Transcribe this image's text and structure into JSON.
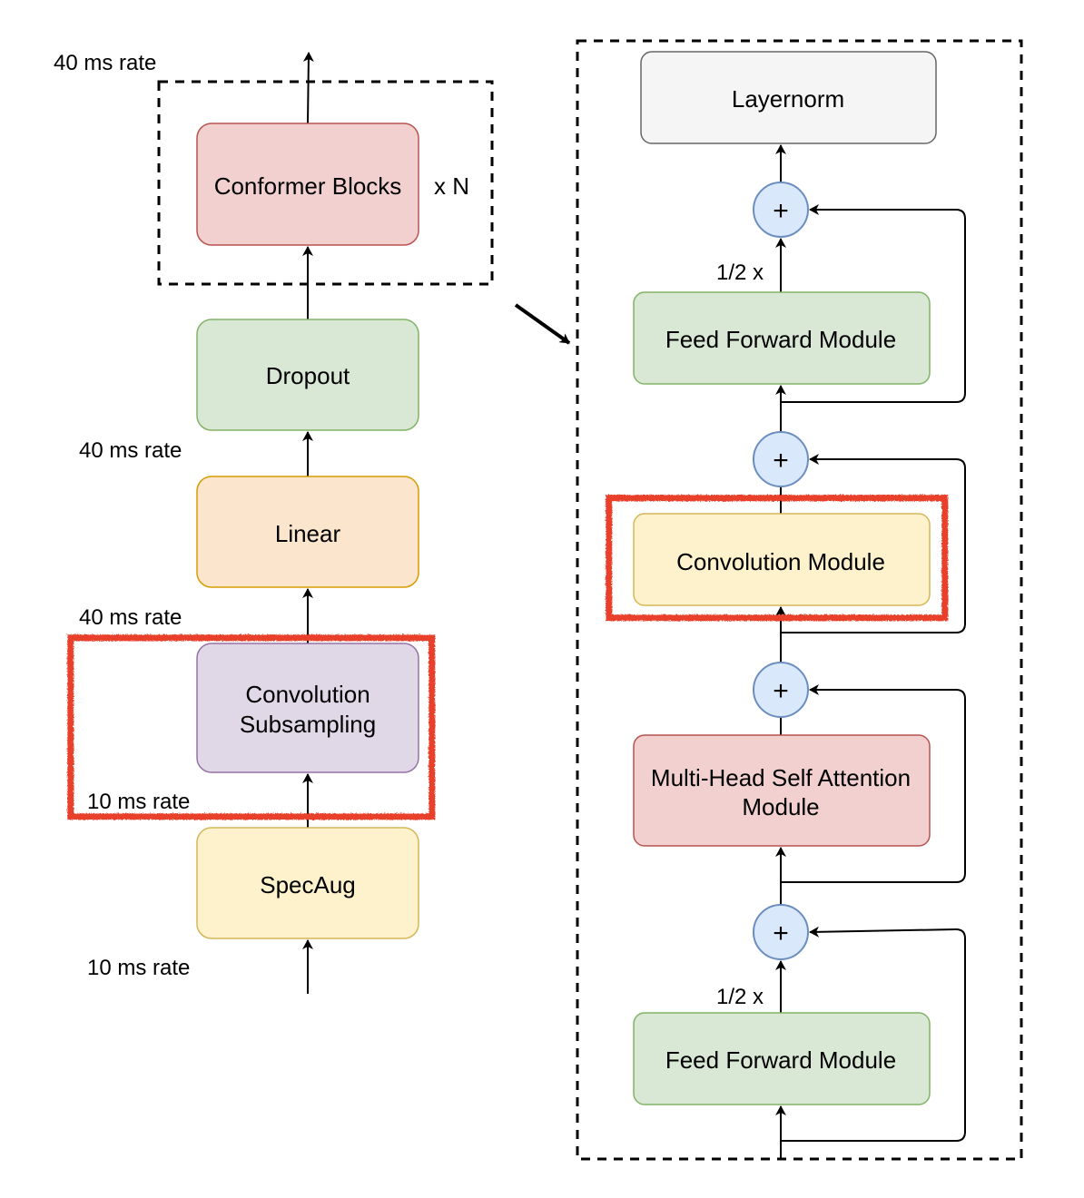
{
  "colors": {
    "red_block": {
      "fill": "#f2d0cf",
      "stroke": "#b85450"
    },
    "green_block": {
      "fill": "#d9e7d5",
      "stroke": "#82b366"
    },
    "orange_block": {
      "fill": "#fbe6cd",
      "stroke": "#d79b00"
    },
    "purple_block": {
      "fill": "#e0d7e7",
      "stroke": "#9673a6"
    },
    "yellow_block": {
      "fill": "#fdf2cc",
      "stroke": "#d6b656"
    },
    "gray_block": {
      "fill": "#f5f5f5",
      "stroke": "#666666"
    },
    "adder": {
      "fill": "#dae8fc",
      "stroke": "#6c8ebf"
    },
    "highlight": "#e8412c"
  },
  "left": {
    "conformer_blocks": "Conformer Blocks",
    "repeat": "x N",
    "dropout": "Dropout",
    "linear": "Linear",
    "conv_sub_line1": "Convolution",
    "conv_sub_line2": "Subsampling",
    "specaug": "SpecAug",
    "rate_top": "40 ms rate",
    "rate_linear_out": "40 ms rate",
    "rate_conv_out": "40 ms rate",
    "rate_conv_in": "10 ms rate",
    "rate_input": "10 ms rate"
  },
  "right": {
    "layernorm": "Layernorm",
    "ff_top": "Feed Forward Module",
    "ff_top_scale": "1/2 x",
    "conv_module": "Convolution Module",
    "mhsa_line1": "Multi-Head Self Attention",
    "mhsa_line2": "Module",
    "ff_bottom": "Feed Forward Module",
    "ff_bottom_scale": "1/2 x",
    "plus": "+"
  }
}
